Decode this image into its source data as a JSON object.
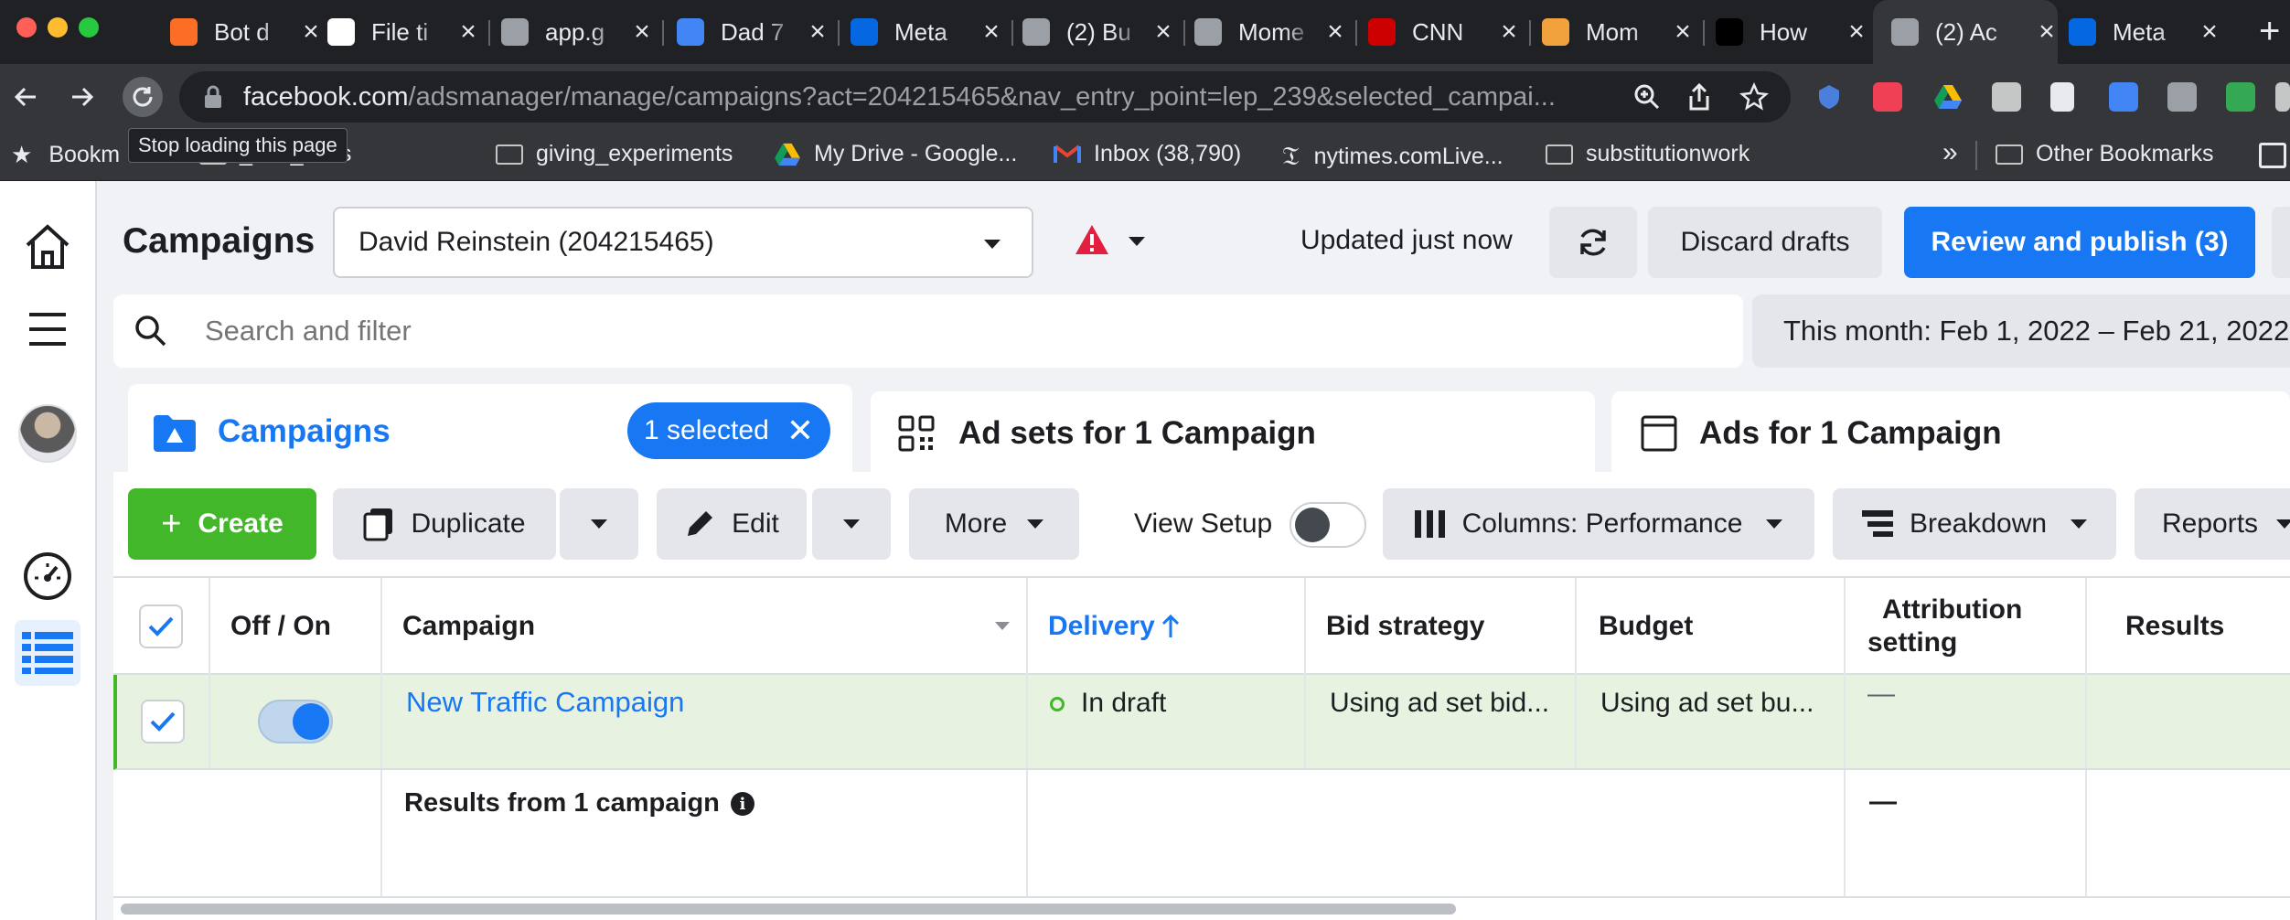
{
  "browser": {
    "tabs": [
      {
        "title": "Bot d",
        "icon": "gitlab-icon",
        "color": "#fc6d26"
      },
      {
        "title": "File ti",
        "icon": "github-icon",
        "color": "#ffffff"
      },
      {
        "title": "app.g",
        "icon": "globe-icon",
        "color": "#9aa0a6"
      },
      {
        "title": "Dad 7",
        "icon": "google-docs-icon",
        "color": "#4285f4"
      },
      {
        "title": "Meta",
        "icon": "meta-icon",
        "color": "#0668e1"
      },
      {
        "title": "(2) Bu",
        "icon": "facebook-ads-icon",
        "color": "#9aa0a6"
      },
      {
        "title": "Mome",
        "icon": "facebook-ads-icon",
        "color": "#9aa0a6"
      },
      {
        "title": "CNN",
        "icon": "cnn-icon",
        "color": "#cc0000"
      },
      {
        "title": "Mom",
        "icon": "generic-a-icon",
        "color": "#f2a23c"
      },
      {
        "title": "How",
        "icon": "tnw-icon",
        "color": "#000000"
      },
      {
        "title": "(2) Ac",
        "icon": "facebook-ads-icon",
        "color": "#9aa0a6",
        "active": true
      },
      {
        "title": "Meta",
        "icon": "meta-icon",
        "color": "#0668e1"
      }
    ],
    "url_domain": "facebook.com",
    "url_path": "/adsmanager/manage/campaigns?act=204215465&nav_entry_point=lep_239&selected_campai...",
    "tooltip": "Stop loading this page",
    "bookmarks": [
      "Bookm",
      "_and_stats",
      "giving_experiments",
      "My Drive - Google...",
      "Inbox (38,790)",
      "nytimes.comLive...",
      "substitutionwork",
      "Other Bookmarks"
    ],
    "bookmarks_overflow": "»"
  },
  "header": {
    "title": "Campaigns",
    "account": "David Reinstein (204215465)",
    "status": "Updated just now",
    "discard": "Discard drafts",
    "publish": "Review and publish (3)"
  },
  "search": {
    "placeholder": "Search and filter",
    "date_range": "This month: Feb 1, 2022 – Feb 21, 2022"
  },
  "levels": {
    "campaigns": "Campaigns",
    "selected": "1 selected",
    "adsets": "Ad sets for 1 Campaign",
    "ads": "Ads for 1 Campaign"
  },
  "actions": {
    "create": "Create",
    "duplicate": "Duplicate",
    "edit": "Edit",
    "more": "More",
    "view_setup": "View Setup",
    "columns": "Columns: Performance",
    "breakdown": "Breakdown",
    "reports": "Reports"
  },
  "table": {
    "headers": {
      "toggle": "Off / On",
      "campaign": "Campaign",
      "delivery": "Delivery",
      "bid": "Bid strategy",
      "budget": "Budget",
      "attribution": "Attribution setting",
      "results": "Results"
    },
    "row": {
      "campaign": "New Traffic Campaign",
      "delivery": "In draft",
      "bid": "Using ad set bid...",
      "budget": "Using ad set bu...",
      "attribution": "—"
    },
    "summary": {
      "label": "Results from 1 campaign",
      "attribution": "—"
    }
  },
  "colors": {
    "brand": "#1877f2",
    "create_green": "#42b72a",
    "selected_row": "#e7f3e0"
  }
}
